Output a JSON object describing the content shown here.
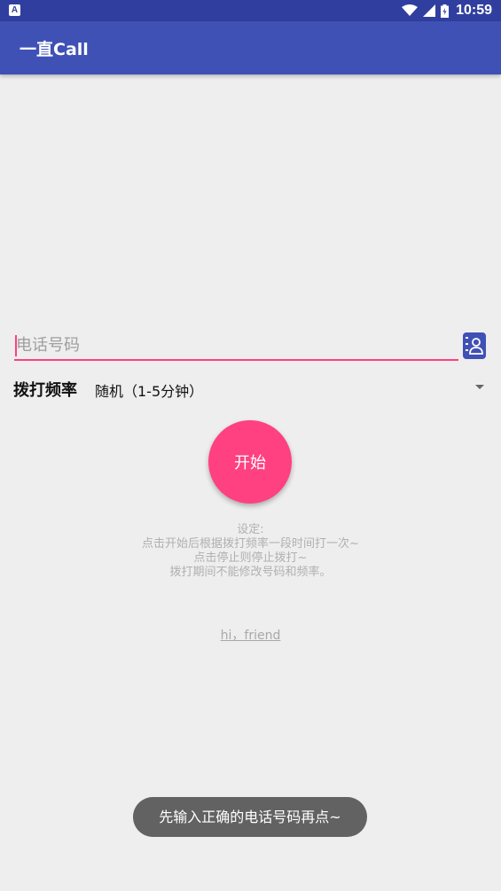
{
  "status_bar": {
    "notification_icon": "A",
    "time": "10:59",
    "icons": [
      "wifi-icon",
      "signal-icon",
      "battery-icon"
    ]
  },
  "app_bar": {
    "title": "一直Call"
  },
  "phone": {
    "placeholder": "电话号码",
    "value": "",
    "contacts_icon": "contacts-icon"
  },
  "frequency": {
    "label": "拨打频率",
    "selected": "随机（1-5分钟）"
  },
  "start_button": {
    "label": "开始"
  },
  "description": {
    "lines": [
      "设定:",
      "点击开始后根据拨打频率一段时间打一次~",
      "点击停止则停止拨打~",
      "拨打期间不能修改号码和频率。"
    ]
  },
  "footer_link": "hi，friend",
  "toast": "先输入正确的电话号码再点~",
  "colors": {
    "status_bar": "#303f9f",
    "app_bar": "#3f51b5",
    "accent": "#ff4081",
    "background": "#eeeeee"
  }
}
